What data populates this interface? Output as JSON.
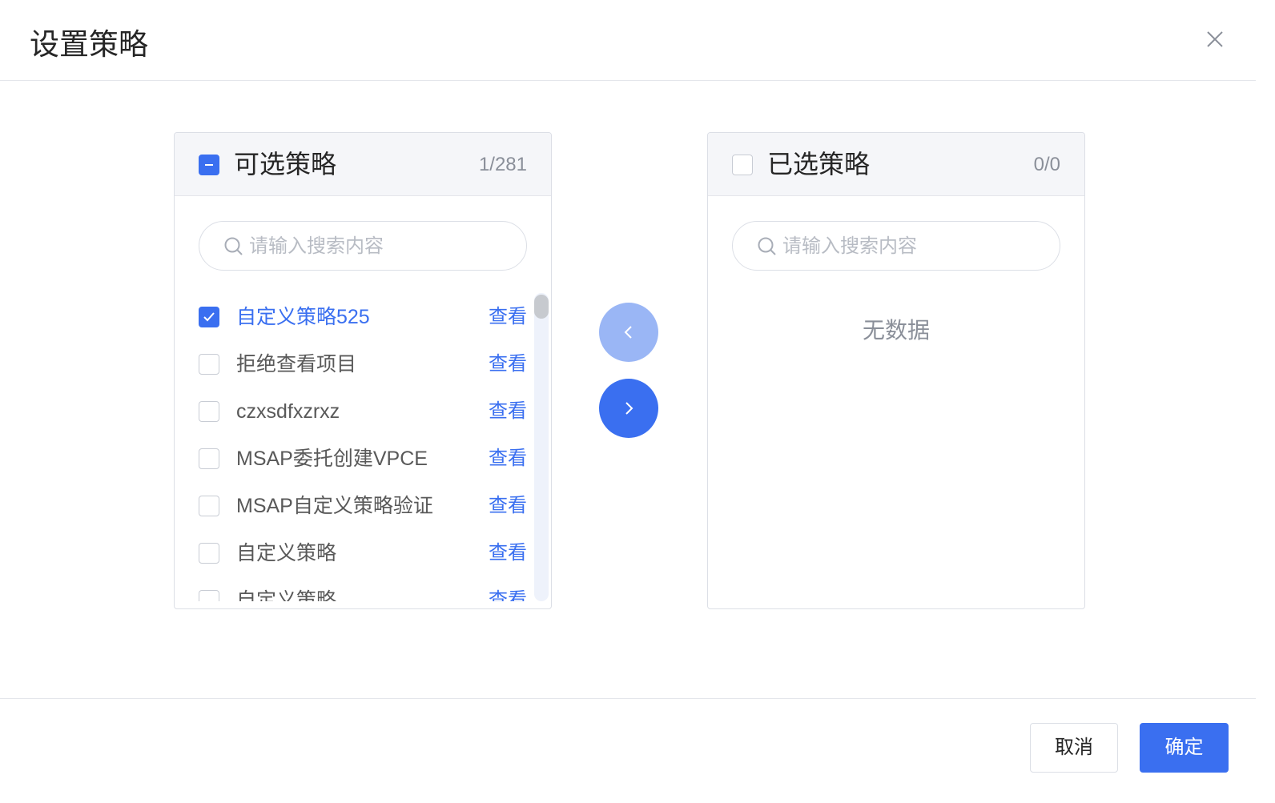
{
  "dialog": {
    "title": "设置策略"
  },
  "source_panel": {
    "title": "可选策略",
    "count": "1/281",
    "search_placeholder": "请输入搜索内容",
    "view_label": "查看",
    "items": [
      {
        "label": "自定义策略525",
        "checked": true
      },
      {
        "label": "拒绝查看项目",
        "checked": false
      },
      {
        "label": "czxsdfxzrxz",
        "checked": false
      },
      {
        "label": "MSAP委托创建VPCE",
        "checked": false
      },
      {
        "label": "MSAP自定义策略验证",
        "checked": false
      },
      {
        "label": "自定义策略",
        "checked": false
      },
      {
        "label": "自定义策略",
        "checked": false
      }
    ]
  },
  "target_panel": {
    "title": "已选策略",
    "count": "0/0",
    "search_placeholder": "请输入搜索内容",
    "empty_text": "无数据"
  },
  "footer": {
    "cancel_label": "取消",
    "ok_label": "确定"
  },
  "colors": {
    "primary": "#3a6ff0",
    "primary_light": "#9ab6f5"
  }
}
